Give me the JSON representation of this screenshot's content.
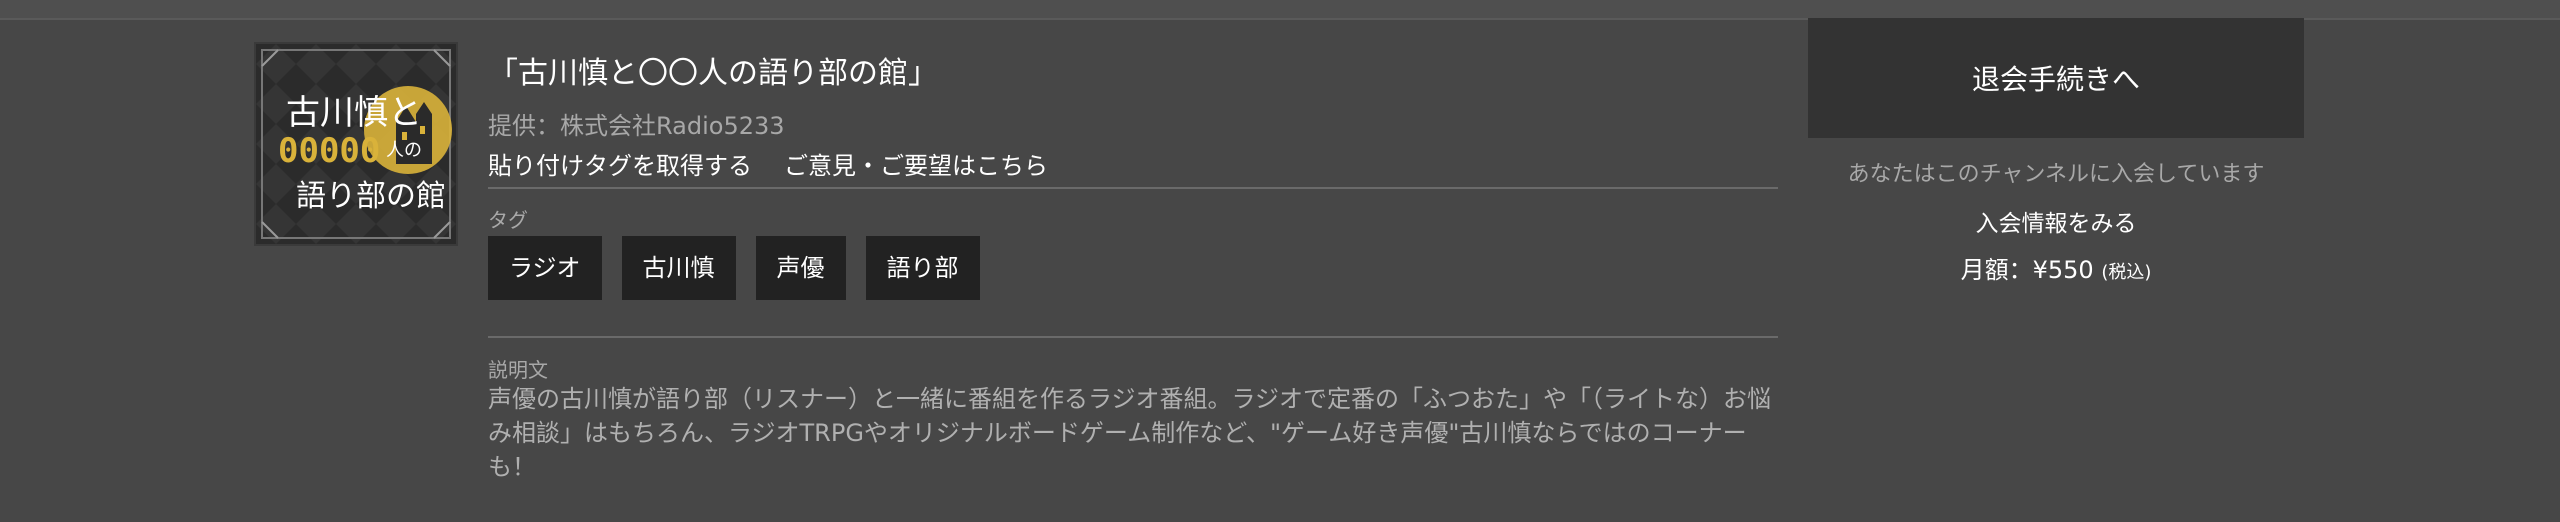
{
  "channel": {
    "title": "「古川慎と〇〇人の語り部の館」",
    "provider": "提供：株式会社Radio5233",
    "links": {
      "embed_tag": "貼り付けタグを取得する",
      "feedback": "ご意見・ご要望はこちら"
    },
    "thumbnail_text": {
      "line1": "古川慎と",
      "line2": "00000",
      "line3": "人の",
      "line4": "語り部の館"
    },
    "tags_label": "タグ",
    "tags": [
      "ラジオ",
      "古川慎",
      "声優",
      "語り部"
    ],
    "description_label": "説明文",
    "description": "声優の古川慎が語り部（リスナー）と一緒に番組を作るラジオ番組。ラジオで定番の「ふつおた」や「（ライトな）お悩み相談」はもちろん、ラジオTRPGやオリジナルボードゲーム制作など、\"ゲーム好き声優\"古川慎ならではのコーナーも！"
  },
  "membership": {
    "withdraw_button": "退会手続きへ",
    "status": "あなたはこのチャンネルに入会しています",
    "info_link": "入会情報をみる",
    "price_label": "月額：¥550",
    "price_tax": "(税込)"
  },
  "colors": {
    "background": "#474747",
    "button": "#333333",
    "tag": "#222222",
    "logo_gold": "#d9b23a"
  }
}
